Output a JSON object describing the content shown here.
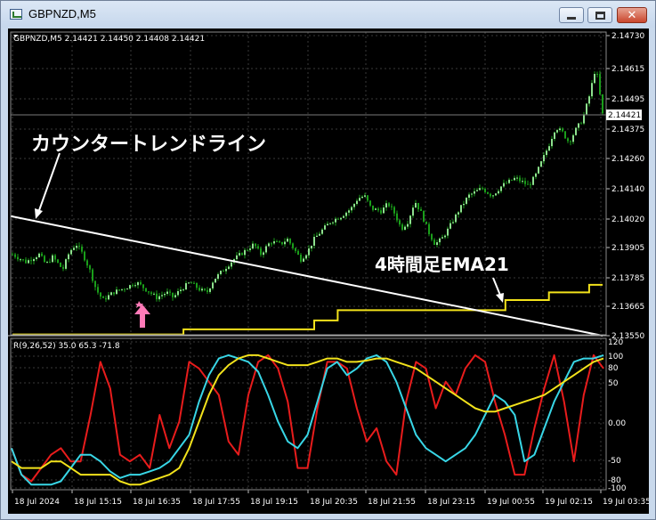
{
  "window": {
    "title": "GBPNZD,M5",
    "controls": {
      "minimize": "minimize-button",
      "maximize": "maximize-button",
      "close": "close-button"
    }
  },
  "chart_info": {
    "header": "GBPNZD,M5  2.14421 2.14450 2.14408 2.14421",
    "price_label": "2.14421"
  },
  "annotations": {
    "countertrend": "カウンタートレンドライン",
    "ema": "4時間足EMA21"
  },
  "indicator": {
    "header": "R(9,26,52) 35.0 65.3 -71.8"
  },
  "colors": {
    "background": "#000000",
    "grid": "#3a3a3a",
    "candle_up": "#1a9e1a",
    "candle_body": "#8ee08e",
    "trendline": "#ffffff",
    "ema": "#f2e21b",
    "osc_red": "#e81c1c",
    "osc_cyan": "#38d6e6",
    "osc_yellow": "#f2e21b",
    "arrow": "#ff7ab8",
    "axis_text": "#ffffff"
  },
  "chart_data": [
    {
      "type": "candlestick",
      "price_axis_ticks": [
        "2.14730",
        "2.14615",
        "2.14495",
        "2.14375",
        "2.14260",
        "2.14140",
        "2.14020",
        "2.13905",
        "2.13785",
        "2.13665",
        "2.13550"
      ],
      "ylim": [
        2.1355,
        2.1473
      ],
      "time_labels": [
        "18 Jul 2024",
        "18 Jul 15:15",
        "18 Jul 16:35",
        "18 Jul 17:55",
        "18 Jul 19:15",
        "18 Jul 20:35",
        "18 Jul 21:55",
        "18 Jul 23:15",
        "19 Jul 00:55",
        "19 Jul 02:15",
        "19 Jul 03:35"
      ],
      "close_path": [
        [
          0,
          2.1387
        ],
        [
          4,
          2.1384
        ],
        [
          8,
          2.1387
        ],
        [
          10,
          2.1383
        ],
        [
          12,
          2.1386
        ],
        [
          15,
          2.1381
        ],
        [
          17,
          2.1388
        ],
        [
          19,
          2.1391
        ],
        [
          21,
          2.1387
        ],
        [
          23,
          2.1381
        ],
        [
          25,
          2.1373
        ],
        [
          27,
          2.1369
        ],
        [
          30,
          2.1372
        ],
        [
          34,
          2.1374
        ],
        [
          37,
          2.1376
        ],
        [
          40,
          2.1373
        ],
        [
          43,
          2.137
        ],
        [
          46,
          2.1372
        ],
        [
          48,
          2.137
        ],
        [
          50,
          2.1373
        ],
        [
          53,
          2.1376
        ],
        [
          56,
          2.1373
        ],
        [
          58,
          2.1372
        ],
        [
          60,
          2.1377
        ],
        [
          63,
          2.1381
        ],
        [
          66,
          2.1385
        ],
        [
          69,
          2.1388
        ],
        [
          72,
          2.1391
        ],
        [
          74,
          2.1387
        ],
        [
          77,
          2.1392
        ],
        [
          80,
          2.1391
        ],
        [
          82,
          2.1393
        ],
        [
          84,
          2.1389
        ],
        [
          86,
          2.1385
        ],
        [
          88,
          2.1388
        ],
        [
          90,
          2.1393
        ],
        [
          92,
          2.1396
        ],
        [
          95,
          2.14
        ],
        [
          98,
          2.1402
        ],
        [
          101,
          2.1405
        ],
        [
          103,
          2.1409
        ],
        [
          105,
          2.141
        ],
        [
          107,
          2.1405
        ],
        [
          110,
          2.1404
        ],
        [
          112,
          2.1407
        ],
        [
          114,
          2.1403
        ],
        [
          116,
          2.1397
        ],
        [
          118,
          2.14
        ],
        [
          120,
          2.1408
        ],
        [
          122,
          2.1403
        ],
        [
          124,
          2.1396
        ],
        [
          126,
          2.1391
        ],
        [
          128,
          2.1393
        ],
        [
          130,
          2.1397
        ],
        [
          133,
          2.1404
        ],
        [
          136,
          2.141
        ],
        [
          140,
          2.1413
        ],
        [
          143,
          2.141
        ],
        [
          146,
          2.1414
        ],
        [
          150,
          2.1417
        ],
        [
          154,
          2.1414
        ],
        [
          156,
          2.1418
        ],
        [
          158,
          2.1424
        ],
        [
          160,
          2.143
        ],
        [
          162,
          2.1437
        ],
        [
          164,
          2.1435
        ],
        [
          166,
          2.1431
        ],
        [
          168,
          2.1436
        ],
        [
          170,
          2.144
        ],
        [
          172,
          2.1449
        ],
        [
          174,
          2.1461
        ],
        [
          176,
          2.1442
        ]
      ],
      "ema21_steps": [
        [
          0,
          2.13555
        ],
        [
          51,
          2.13555
        ],
        [
          51,
          2.13575
        ],
        [
          90,
          2.13575
        ],
        [
          90,
          2.1361
        ],
        [
          97,
          2.1361
        ],
        [
          97,
          2.1365
        ],
        [
          147,
          2.1365
        ],
        [
          147,
          2.1369
        ],
        [
          160,
          2.1369
        ],
        [
          160,
          2.1372
        ],
        [
          172,
          2.1372
        ],
        [
          172,
          2.1375
        ],
        [
          176,
          2.1375
        ]
      ],
      "trendline": [
        [
          0,
          2.1402
        ],
        [
          176,
          2.1355
        ]
      ]
    },
    {
      "type": "line",
      "title": "R(9,26,52) 35.0 65.3 -71.8",
      "y_ticks": [
        "120",
        "100",
        "80",
        "50",
        "0.00",
        "-50",
        "-80",
        "-100"
      ],
      "ylim": [
        -100,
        120
      ],
      "series": [
        {
          "values": [
            -40,
            -80,
            -90,
            -70,
            -50,
            -40,
            -60,
            -60,
            10,
            90,
            50,
            -50,
            -60,
            -50,
            -70,
            10,
            -40,
            0,
            90,
            80,
            60,
            40,
            -30,
            -50,
            40,
            90,
            100,
            80,
            30,
            -70,
            -70,
            20,
            90,
            90,
            80,
            20,
            -30,
            -10,
            -60,
            -80,
            30,
            90,
            80,
            20,
            60,
            40,
            80,
            100,
            90,
            30,
            -20,
            -80,
            -80,
            -10,
            50,
            100,
            30,
            -60,
            40,
            100,
            80
          ]
        },
        {
          "values": [
            -40,
            -80,
            -95,
            -95,
            -95,
            -90,
            -70,
            -50,
            -50,
            -60,
            -75,
            -85,
            -80,
            -80,
            -75,
            -70,
            -60,
            -40,
            -20,
            30,
            70,
            95,
            100,
            95,
            90,
            75,
            40,
            0,
            -30,
            -40,
            -20,
            30,
            80,
            90,
            70,
            80,
            95,
            100,
            90,
            60,
            20,
            -20,
            -40,
            -50,
            -60,
            -50,
            -40,
            -20,
            10,
            40,
            30,
            10,
            -60,
            -50,
            -10,
            30,
            60,
            90,
            95,
            95,
            100
          ]
        },
        {
          "values": [
            -60,
            -70,
            -70,
            -70,
            -60,
            -60,
            -70,
            -80,
            -80,
            -80,
            -80,
            -90,
            -95,
            -95,
            -90,
            -85,
            -80,
            -70,
            -40,
            0,
            40,
            70,
            85,
            95,
            100,
            100,
            95,
            90,
            85,
            85,
            85,
            90,
            95,
            95,
            90,
            90,
            92,
            95,
            95,
            90,
            85,
            80,
            70,
            60,
            50,
            40,
            30,
            20,
            15,
            15,
            20,
            25,
            30,
            35,
            40,
            50,
            60,
            70,
            80,
            90,
            95
          ]
        }
      ]
    }
  ]
}
